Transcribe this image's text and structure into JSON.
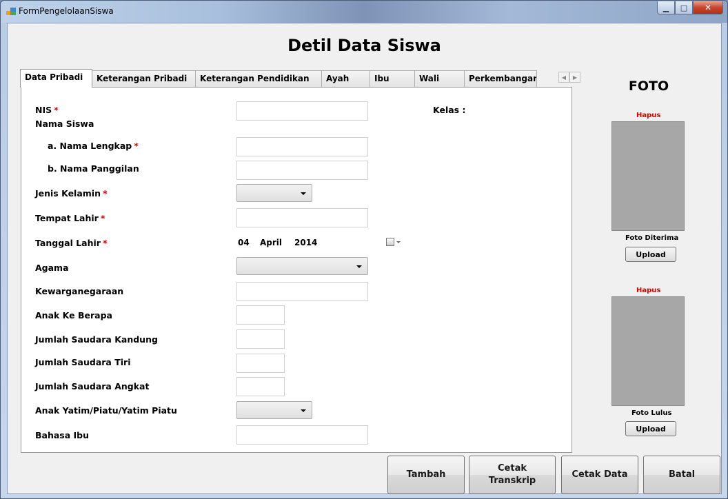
{
  "window": {
    "title": "FormPengelolaanSiswa"
  },
  "page": {
    "title": "Detil Data Siswa"
  },
  "tabs": [
    "Data Pribadi",
    "Keterangan Pribadi",
    "Keterangan Pendidikan",
    "Ayah",
    "Ibu",
    "Wali",
    "Perkembangan Siswa"
  ],
  "form": {
    "nis": "NIS",
    "nama_siswa": "Nama Siswa",
    "nama_lengkap": "a. Nama Lengkap",
    "nama_panggilan": "b. Nama Panggilan",
    "jenis_kelamin": "Jenis Kelamin",
    "tempat_lahir": "Tempat Lahir",
    "tanggal_lahir": "Tanggal Lahir",
    "agama": "Agama",
    "kewarganegaraan": "Kewarganegaraan",
    "anak_ke": "Anak Ke Berapa",
    "saudara_kandung": "Jumlah Saudara Kandung",
    "saudara_tiri": "Jumlah Saudara Tiri",
    "saudara_angkat": "Jumlah Saudara Angkat",
    "anak_yatim": "Anak Yatim/Piatu/Yatim Piatu",
    "bahasa_ibu": "Bahasa Ibu",
    "kelas": "Kelas :",
    "required_mark": "*",
    "date": {
      "day": "04",
      "month": "April",
      "year": "2014"
    }
  },
  "photo": {
    "title": "FOTO",
    "hapus": "Hapus",
    "caption_diterima": "Foto Diterima",
    "caption_lulus": "Foto Lulus",
    "upload": "Upload"
  },
  "buttons": {
    "tambah": "Tambah",
    "cetak_transkrip_1": "Cetak",
    "cetak_transkrip_2": "Transkrip",
    "cetak_data": "Cetak  Data",
    "batal": "Batal"
  }
}
